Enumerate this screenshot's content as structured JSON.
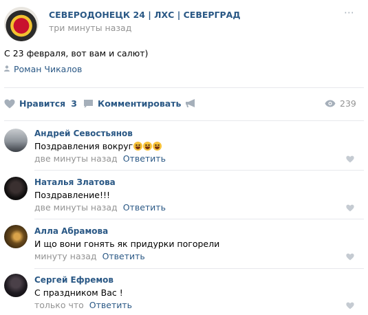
{
  "post": {
    "community": "СЕВЕРОДОНЕЦК 24 | ЛХС | СЕВЕРГРАД",
    "time": "три минуты назад",
    "text": "С 23 февраля, вот вам и салют)",
    "author": "Роман Чикалов"
  },
  "actions": {
    "like_label": "Нравится",
    "like_count": "3",
    "comment_label": "Комментировать",
    "views": "239"
  },
  "comments": [
    {
      "name": "Андрей Севостьянов",
      "text": "Поздравления вокруг",
      "emoji_count": 3,
      "time": "две минуты назад",
      "reply": "Ответить"
    },
    {
      "name": "Наталья Златова",
      "text": "Поздравление!!!",
      "time": "две минуты назад",
      "reply": "Ответить"
    },
    {
      "name": "Алла Абрамова",
      "text": "И що вони гонять як придурки погорели",
      "time": "минуту назад",
      "reply": "Ответить"
    },
    {
      "name": "Сергей Ефремов",
      "text": "С праздником Вас !",
      "time": "только что",
      "reply": "Ответить"
    }
  ],
  "colors": {
    "link": "#2a5885",
    "muted": "#939393",
    "icon": "#a5afba",
    "divider": "#e7e8ec"
  }
}
